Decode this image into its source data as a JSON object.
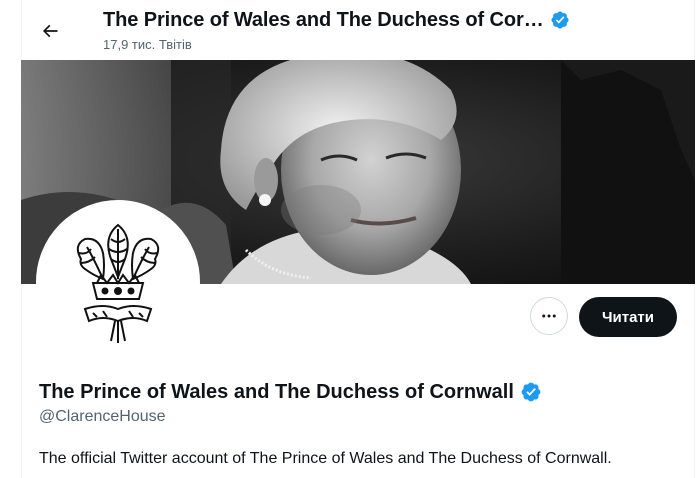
{
  "header": {
    "back_icon": "arrow-left-icon",
    "title": "The Prince of Wales and The Duchess of Cor…",
    "tweet_count": "17,9 тис. Твітів",
    "verified_icon": "verified-badge-icon"
  },
  "banner": {
    "description_icon": "portrait-photo"
  },
  "avatar": {
    "icon": "prince-of-wales-feathers-emblem"
  },
  "actions": {
    "more_icon": "more-dots-icon",
    "follow_label": "Читати"
  },
  "profile": {
    "name": "The Prince of Wales and The Duchess of Cornwall",
    "handle": "@ClarenceHouse",
    "bio": "The official Twitter account of The Prince of Wales and The Duchess of Cornwall.",
    "link_partial": "",
    "verified_color": "#1d9bf0"
  },
  "colors": {
    "text_primary": "#0f1419",
    "text_secondary": "#536471",
    "accent": "#1d9bf0",
    "border": "#eff3f4"
  }
}
